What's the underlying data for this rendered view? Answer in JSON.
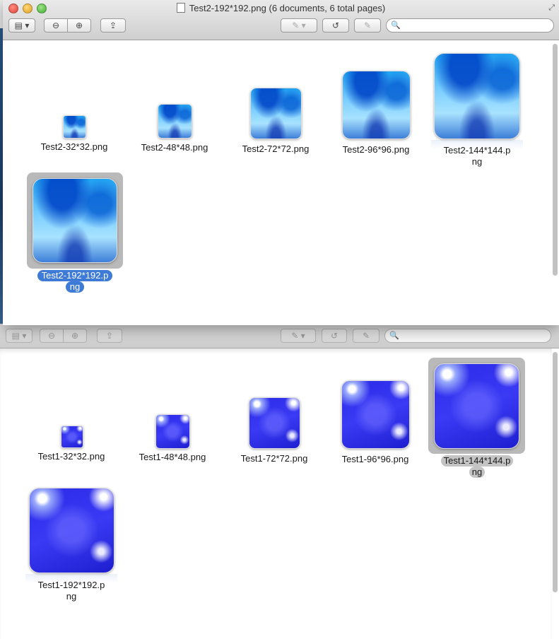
{
  "window": {
    "title": "Test2-192*192.png (6 documents, 6 total pages)"
  },
  "toolbar": {
    "sidebar_button": "▤ ▾",
    "zoom_out": "⊖",
    "zoom_in": "⊕",
    "share": "⇪",
    "annotate": "✎ ▾",
    "rotate": "↺",
    "edit": "✎",
    "search_placeholder": ""
  },
  "front_documents": [
    {
      "name": "Test2-32*32.png",
      "selected": false
    },
    {
      "name": "Test2-48*48.png",
      "selected": false
    },
    {
      "name": "Test2-72*72.png",
      "selected": false
    },
    {
      "name": "Test2-96*96.png",
      "selected": false
    },
    {
      "name": "Test2-144*144.p\nng",
      "line1": "Test2-144*144.p",
      "line2": "ng",
      "selected": false
    },
    {
      "name": "Test2-192*192.png",
      "line1": "Test2-192*192.p",
      "line2": "ng",
      "selected": true
    }
  ],
  "back_documents": [
    {
      "name": "Test1-32*32.png",
      "selected": false
    },
    {
      "name": "Test1-48*48.png",
      "selected": false
    },
    {
      "name": "Test1-72*72.png",
      "selected": false
    },
    {
      "name": "Test1-96*96.png",
      "selected": false
    },
    {
      "name": "Test1-144*144.png",
      "line1": "Test1-144*144.p",
      "line2": "ng",
      "selected": true
    },
    {
      "name": "Test1-192*192.png",
      "line1": "Test1-192*192.p",
      "line2": "ng",
      "selected": false
    }
  ],
  "colors": {
    "selection_blue": "#3d7bd6",
    "selection_gray": "#c4c4c4"
  }
}
